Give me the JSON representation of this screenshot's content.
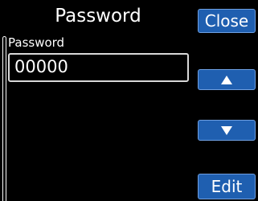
{
  "screen": {
    "title": "Password"
  },
  "form": {
    "field_label": "Password",
    "field_value": "00000"
  },
  "buttons": {
    "close_label": "Close",
    "up_icon": "triangle-up",
    "down_icon": "triangle-down",
    "edit_label": "Edit"
  },
  "colors": {
    "background": "#000000",
    "button": "#1f5fb0",
    "text": "#ffffff"
  }
}
